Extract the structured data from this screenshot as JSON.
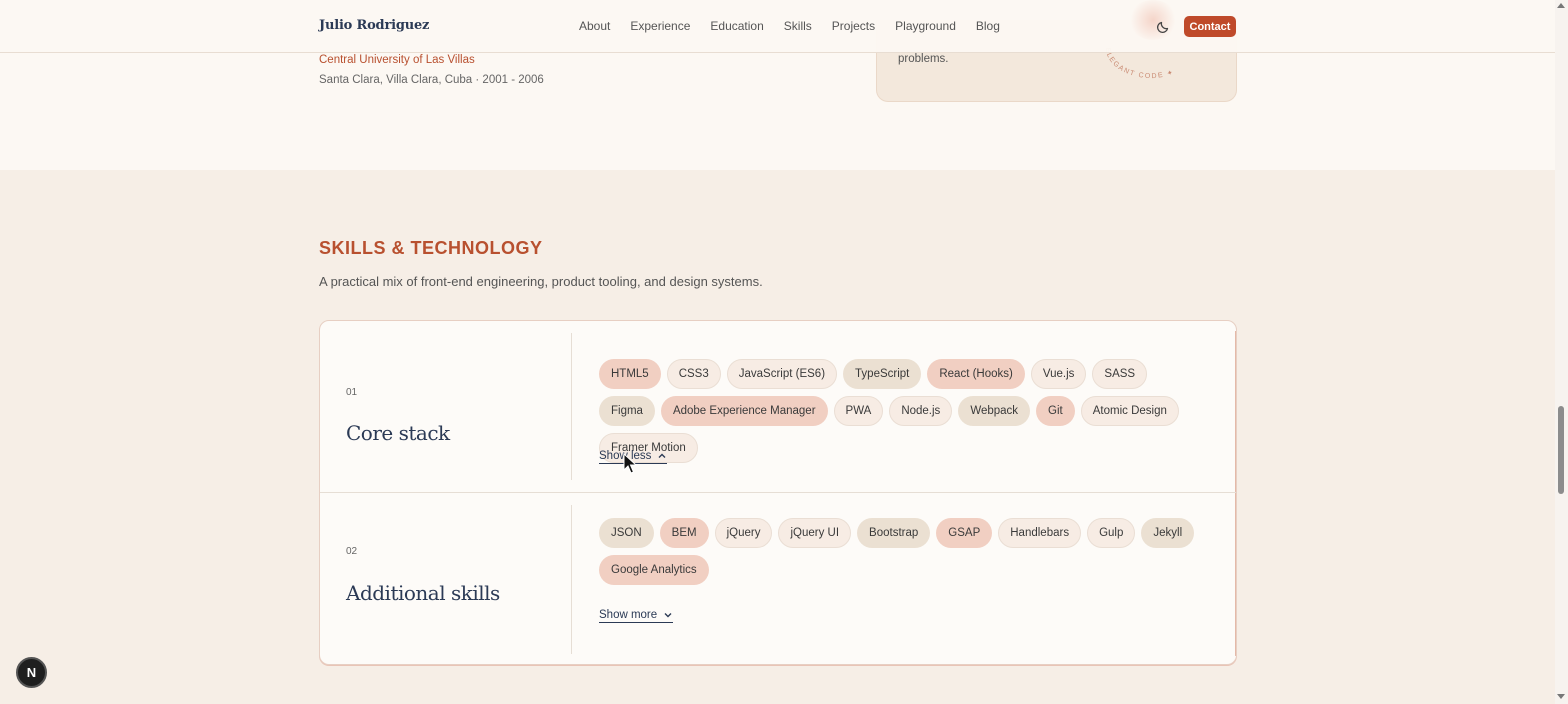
{
  "header": {
    "brand": "Julio Rodriguez",
    "nav": [
      "About",
      "Experience",
      "Education",
      "Skills",
      "Projects",
      "Playground",
      "Blog"
    ],
    "contact_label": "Contact",
    "accent_color": "#bf4a2a"
  },
  "education": {
    "school": "Central University of Las Villas",
    "meta": "Santa Clara, Villa Clara, Cuba · 2001 - 2006",
    "card_text": "problems.",
    "badge_text": "ELEGANT CODE ✦"
  },
  "skills": {
    "title": "SKILLS & TECHNOLOGY",
    "subtitle": "A practical mix of front-end engineering, product tooling, and design systems.",
    "groups": [
      {
        "num": "01",
        "title": "Core stack",
        "toggle": "Show less",
        "toggle_icon": "chevron-up-icon",
        "chips": [
          {
            "label": "HTML5",
            "tone": "pink"
          },
          {
            "label": "CSS3",
            "tone": "light"
          },
          {
            "label": "JavaScript (ES6)",
            "tone": "light"
          },
          {
            "label": "TypeScript",
            "tone": "tan"
          },
          {
            "label": "React (Hooks)",
            "tone": "pink"
          },
          {
            "label": "Vue.js",
            "tone": "light"
          },
          {
            "label": "SASS",
            "tone": "light"
          },
          {
            "label": "Figma",
            "tone": "tan"
          },
          {
            "label": "Adobe Experience Manager",
            "tone": "pink"
          },
          {
            "label": "PWA",
            "tone": "light"
          },
          {
            "label": "Node.js",
            "tone": "light"
          },
          {
            "label": "Webpack",
            "tone": "tan"
          },
          {
            "label": "Git",
            "tone": "pink"
          },
          {
            "label": "Atomic Design",
            "tone": "light"
          },
          {
            "label": "Framer Motion",
            "tone": "light"
          }
        ]
      },
      {
        "num": "02",
        "title": "Additional skills",
        "toggle": "Show more",
        "toggle_icon": "chevron-down-icon",
        "chips": [
          {
            "label": "JSON",
            "tone": "tan"
          },
          {
            "label": "BEM",
            "tone": "pink"
          },
          {
            "label": "jQuery",
            "tone": "light"
          },
          {
            "label": "jQuery UI",
            "tone": "light"
          },
          {
            "label": "Bootstrap",
            "tone": "tan"
          },
          {
            "label": "GSAP",
            "tone": "pink"
          },
          {
            "label": "Handlebars",
            "tone": "light"
          },
          {
            "label": "Gulp",
            "tone": "light"
          },
          {
            "label": "Jekyll",
            "tone": "tan"
          },
          {
            "label": "Google Analytics",
            "tone": "pink"
          }
        ]
      }
    ]
  },
  "dev_badge": "N"
}
